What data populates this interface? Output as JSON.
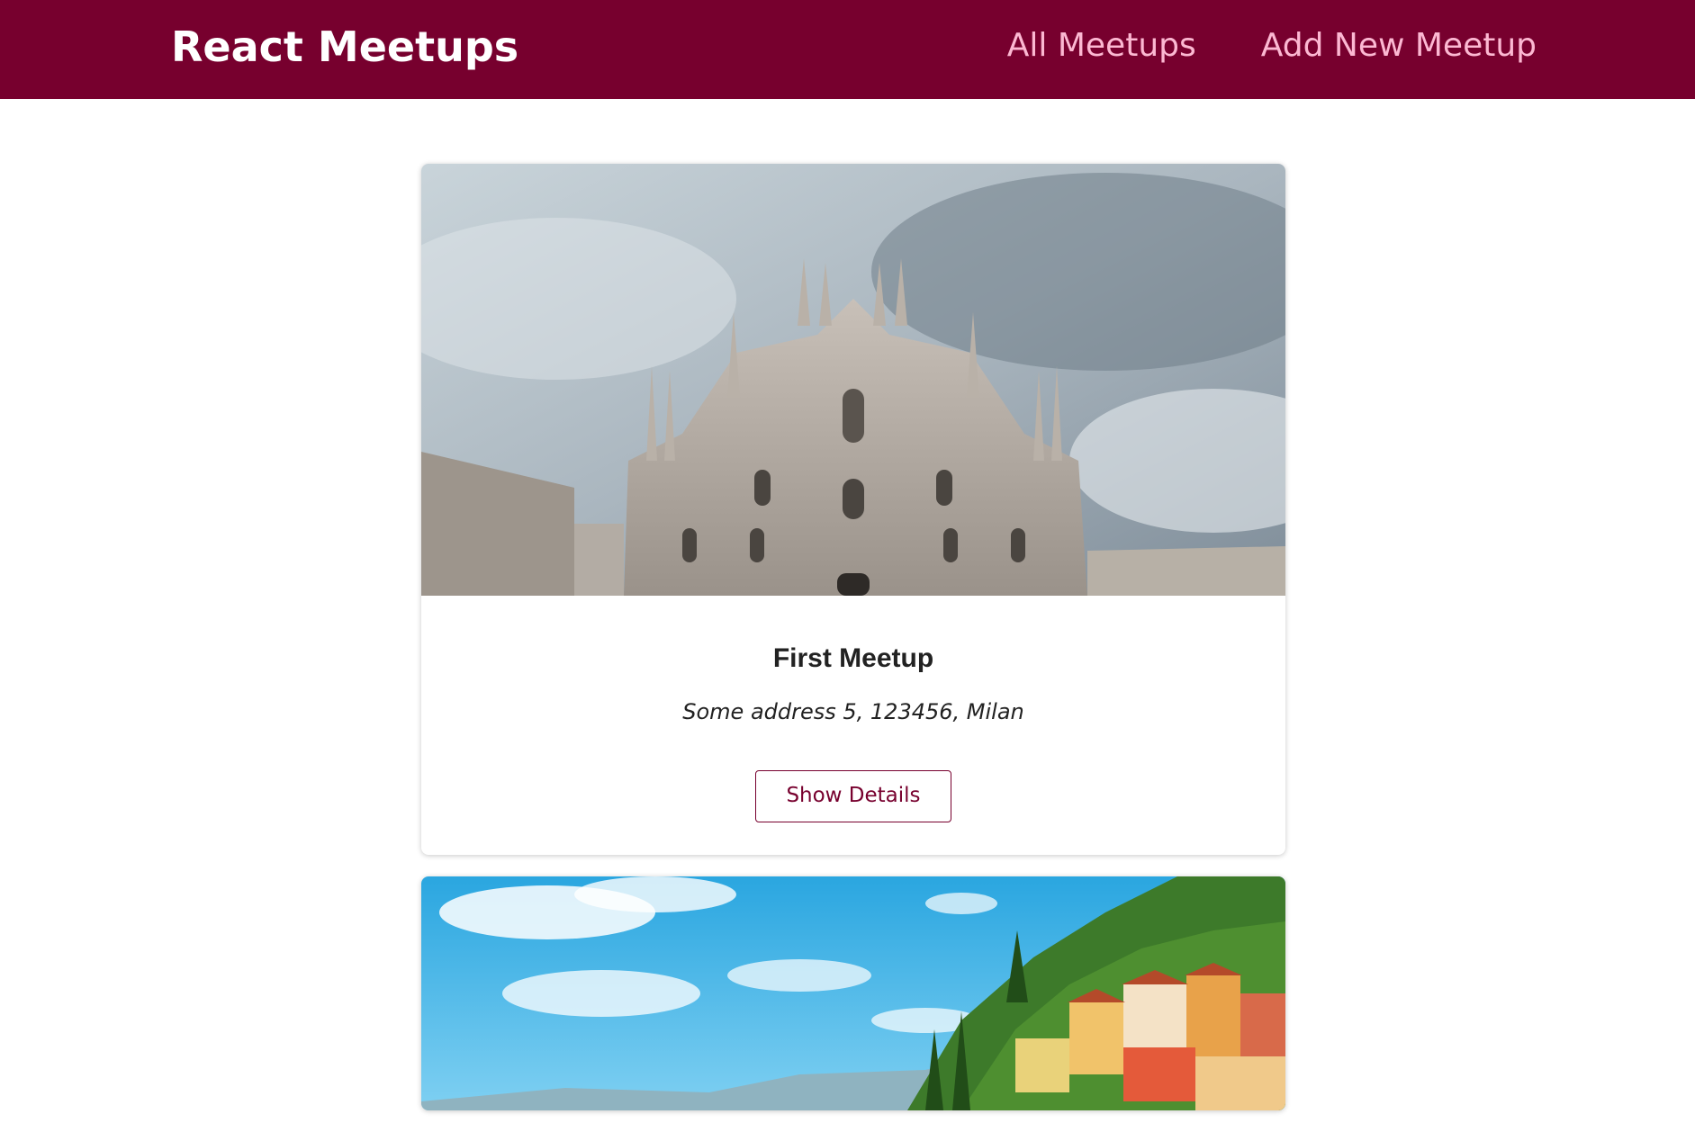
{
  "header": {
    "logo": "React Meetups",
    "nav": [
      {
        "label": "All Meetups"
      },
      {
        "label": "Add New Meetup"
      }
    ]
  },
  "meetups": [
    {
      "title": "First Meetup",
      "address": "Some address 5, 123456, Milan",
      "button_label": "Show Details",
      "image_subject": "cathedral-photo"
    },
    {
      "image_subject": "lakeside-village-photo"
    }
  ],
  "colors": {
    "header_bg": "#77002e",
    "nav_link": "#fcb8d2",
    "accent": "#77002e"
  }
}
